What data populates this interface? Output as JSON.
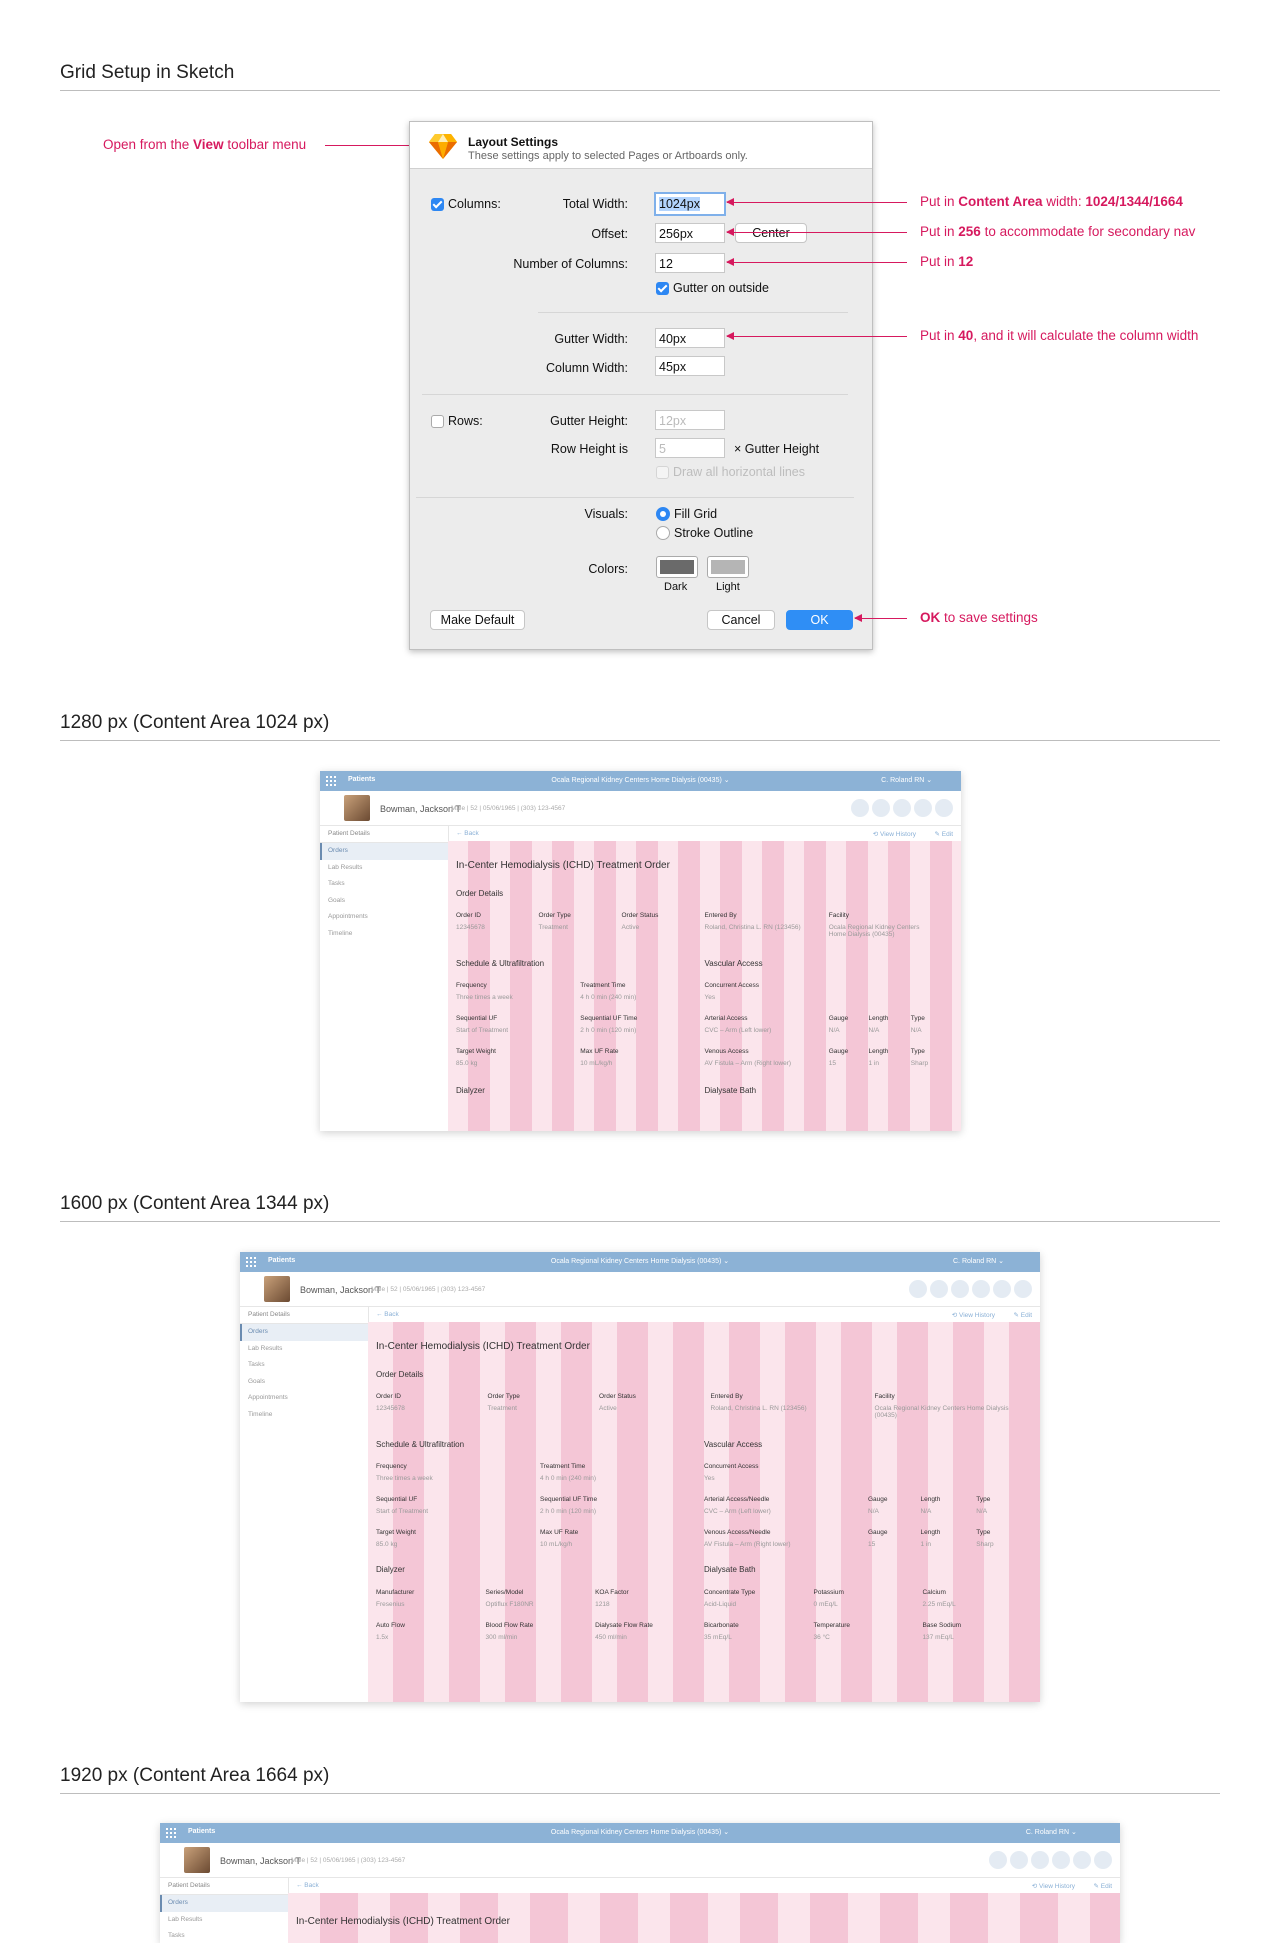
{
  "sections": {
    "grid_setup": "Grid Setup in Sketch",
    "s1280": "1280 px (Content Area 1024 px)",
    "s1600": "1600 px (Content Area 1344 px)",
    "s1920": "1920 px (Content Area 1664 px)"
  },
  "annotations": {
    "open_from": {
      "pre": "Open from the ",
      "bold": "View",
      "post": " toolbar menu"
    },
    "content_area": {
      "pre": "Put in ",
      "bold": "Content Area",
      "mid": " width: ",
      "bold2": "1024/1344/1664"
    },
    "offset": {
      "pre": "Put in ",
      "bold": "256",
      "post": " to accommodate for secondary nav"
    },
    "columns": {
      "pre": "Put in ",
      "bold": "12"
    },
    "gutter": {
      "pre": "Put in ",
      "bold": "40",
      "post": ", and it will calculate the column width"
    },
    "ok": {
      "bold": "OK",
      "post": " to save settings"
    }
  },
  "dialog": {
    "title": "Layout Settings",
    "subtitle": "These settings apply to selected Pages or Artboards only.",
    "columns_label": "Columns:",
    "total_width_label": "Total Width:",
    "total_width_value": "1024px",
    "offset_label": "Offset:",
    "offset_value": "256px",
    "center_button": "Center",
    "num_columns_label": "Number of Columns:",
    "num_columns_value": "12",
    "gutter_outside_label": "Gutter on outside",
    "gutter_width_label": "Gutter Width:",
    "gutter_width_value": "40px",
    "column_width_label": "Column Width:",
    "column_width_value": "45px",
    "rows_label": "Rows:",
    "gutter_height_label": "Gutter Height:",
    "gutter_height_placeholder": "12px",
    "row_height_label": "Row Height is",
    "row_height_placeholder": "5",
    "row_height_suffix": "× Gutter Height",
    "draw_lines_label": "Draw all horizontal lines",
    "visuals_label": "Visuals:",
    "fill_grid": "Fill Grid",
    "stroke_outline": "Stroke Outline",
    "colors_label": "Colors:",
    "dark_label": "Dark",
    "light_label": "Light",
    "make_default": "Make Default",
    "cancel": "Cancel",
    "ok": "OK",
    "columns_checked": true,
    "gutter_outside_checked": true,
    "rows_checked": false,
    "visuals_selected": "Fill Grid",
    "dark_color": "#6a6a6a",
    "light_color": "#b5b5b5"
  },
  "app": {
    "nav_title": "Patients",
    "facility": "Ocala Regional Kidney Centers Home Dialysis (00435) ⌄",
    "user": "C. Roland RN  ⌄",
    "patient_name": "Bowman, Jackson T",
    "patient_meta": "Male | 52 | 05/06/1965 | (303) 123-4567",
    "side_header": "Patient Details",
    "side_items": [
      "Orders",
      "Lab Results",
      "Tasks",
      "Goals",
      "Appointments",
      "Timeline"
    ],
    "back": "← Back",
    "view_history": "View History",
    "edit": "Edit",
    "page_title": "In-Center Hemodialysis (ICHD) Treatment Order",
    "order_details": "Order Details",
    "order_fields": [
      {
        "label": "Order ID",
        "value": "12345678"
      },
      {
        "label": "Order Type",
        "value": "Treatment"
      },
      {
        "label": "Order Status",
        "value": "Active"
      },
      {
        "label": "Entered By",
        "value": "Roland, Christina L. RN (123456)"
      },
      {
        "label": "Facility",
        "value": "Ocala Regional Kidney Centers Home Dialysis (00435)"
      }
    ],
    "schedule": "Schedule & Ultrafiltration",
    "vascular": "Vascular Access",
    "sched_fields": [
      {
        "label": "Frequency",
        "value": "Three times a week"
      },
      {
        "label": "Treatment Time",
        "value": "4 h 0 min (240 min)"
      },
      {
        "label": "Sequential UF",
        "value": "Start of Treatment"
      },
      {
        "label": "Sequential UF Time",
        "value": "2 h 0 min (120 min)"
      },
      {
        "label": "Target Weight",
        "value": "85.0 kg"
      },
      {
        "label": "Max UF Rate",
        "value": "10 mL/kg/h"
      }
    ],
    "vasc_fields": {
      "concurrent_label": "Concurrent Access",
      "concurrent_value": "Yes",
      "arterial_label": "Arterial Access",
      "arterial_label_wide": "Arterial Access/Needle",
      "arterial_value": "CVC – Arm (Left lower)",
      "venous_label": "Venous Access",
      "venous_label_wide": "Venous Access/Needle",
      "venous_value": "AV Fistula – Arm (Right lower)",
      "gauge": "Gauge",
      "length": "Length",
      "type": "Type",
      "na": "N/A",
      "gauge_v": "15",
      "length_v": "1 in",
      "type_v": "Sharp"
    },
    "dialyzer": "Dialyzer",
    "dialysate": "Dialysate Bath",
    "dialyzer_fields": [
      {
        "label": "Manufacturer",
        "value": "Fresenius"
      },
      {
        "label": "Series/Model",
        "value": "Optiflux F180NR"
      },
      {
        "label": "KOA Factor",
        "value": "1218"
      },
      {
        "label": "Auto Flow",
        "value": "1.5x"
      },
      {
        "label": "Blood Flow Rate",
        "value": "300 ml/min"
      },
      {
        "label": "Dialysate Flow Rate",
        "value": "450 ml/min"
      }
    ],
    "dialysate_fields": [
      {
        "label": "Concentrate Type",
        "value": "Acid-Liquid"
      },
      {
        "label": "Potassium",
        "value": "0 mEq/L"
      },
      {
        "label": "Calcium",
        "value": "2.25 mEq/L"
      },
      {
        "label": "Bicarbonate",
        "value": "35 mEq/L"
      },
      {
        "label": "Temperature",
        "value": "36 °C"
      },
      {
        "label": "Base Sodium",
        "value": "137 mEq/L"
      }
    ]
  },
  "colors": {
    "accent": "#d6195e",
    "grid_column": "#f4c6d6",
    "grid_gutter": "#fbe5ec",
    "app_bar": "#8cb2d6"
  }
}
